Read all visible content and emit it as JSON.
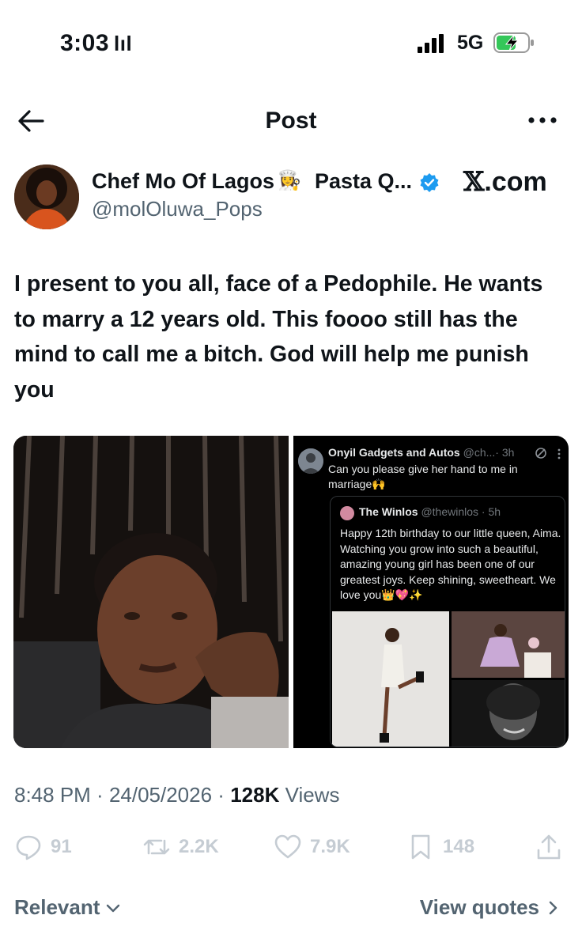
{
  "status_bar": {
    "time": "3:03",
    "time_glyph": "lıl",
    "network": "5G"
  },
  "header": {
    "title": "Post",
    "back_icon": "back-arrow-icon",
    "more_icon": "more-horizontal-icon"
  },
  "author": {
    "name": "Chef Mo Of Lagos",
    "name_emoji": "👩‍🍳",
    "name_suffix": "Pasta Q...",
    "handle": "@molOluwa_Pops",
    "verified": true,
    "source_x": "𝕏",
    "source_suffix": ".com"
  },
  "post": {
    "text": "I present to you all, face of a Pedophile. He wants to marry a 12 years old.  This foooo still has the mind to call me a bitch. God will help me punish you"
  },
  "embedded": {
    "name": "Onyil Gadgets and Autos",
    "handle": "@ch...",
    "time": "· 3h",
    "body": "Can you please give her hand to me in marriage🙌",
    "quote": {
      "name": "The Winlos",
      "handle": "@thewinlos",
      "time": "· 5h",
      "body": "Happy 12th birthday to our little queen, Aima. Watching you grow into such a beautiful, amazing young girl has been one of our greatest joys. Keep shining, sweetheart. We love you👑💖✨"
    }
  },
  "meta": {
    "time": "8:48 PM",
    "sep1": " · ",
    "date": "24/05/2026",
    "sep2": " · ",
    "views": "128K",
    "views_label": " Views"
  },
  "actions": {
    "replies": "91",
    "reposts": "2.2K",
    "likes": "7.9K",
    "bookmarks": "148"
  },
  "footer": {
    "sort_label": "Relevant",
    "quotes_label": "View quotes"
  },
  "colors": {
    "text": "#0f1419",
    "secondary": "#536471",
    "verified": "#1d9bf0",
    "battery_fill": "#34c759"
  }
}
